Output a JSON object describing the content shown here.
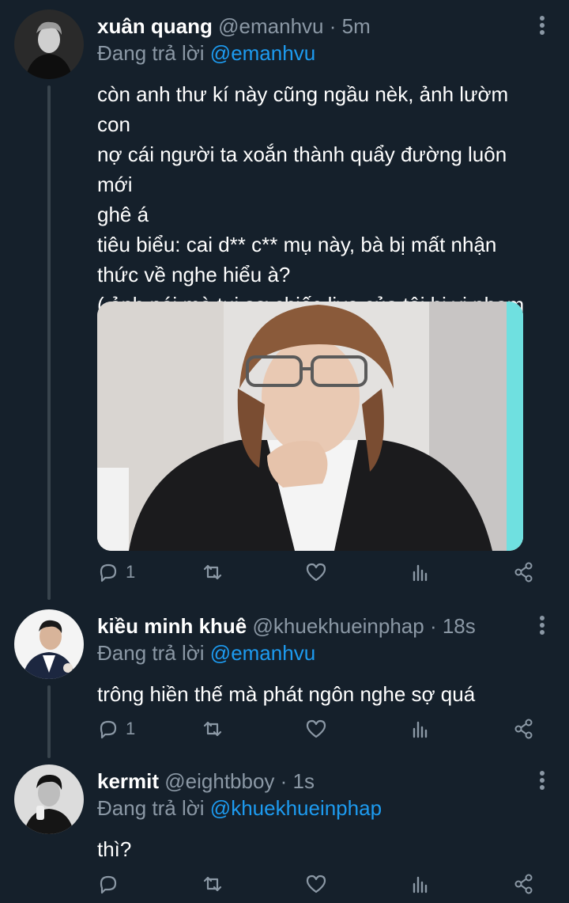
{
  "tweets": [
    {
      "name": "xuân quang",
      "handle": "@emanhvu",
      "time": "· 5m",
      "reply_prefix": "Đang trả lời",
      "reply_to": "@emanhvu",
      "text": "còn anh thư kí này cũng ngầu nèk, ảnh lườm con\nnợ cái người ta xoắn thành quẩy đường luôn mới\nghê á\ntiêu biểu: cai d** c** mụ này, bà bị mất nhận\nthức về nghe hiểu à?\n( ảnh nói mà tui sợ chiếc live của tôi bị vi phạm\ntiêu chuẩn cộng đồng",
      "text_suffix": ")",
      "reply_count": "1",
      "avatar_icon": "user-avatar-icon"
    },
    {
      "name": "kiều minh khuê",
      "handle": "@khuekhueinphap",
      "time": "· 18s",
      "reply_prefix": "Đang trả lời",
      "reply_to": "@emanhvu",
      "text": "trông hiền thế mà phát ngôn nghe sợ quá",
      "reply_count": "1",
      "avatar_icon": "user-avatar-icon"
    },
    {
      "name": "kermit",
      "handle": "@eightbboy",
      "time": "· 1s",
      "reply_prefix": "Đang trả lời",
      "reply_to": "@khuekhueinphap",
      "text": "thì?",
      "reply_count": "",
      "avatar_icon": "user-avatar-icon"
    }
  ],
  "icons": {
    "reply": "reply-icon",
    "retweet": "retweet-icon",
    "like": "heart-icon",
    "views": "views-icon",
    "share": "share-icon",
    "more": "more-options-icon",
    "emoji": "loudly-crying-face-emoji"
  },
  "colors": {
    "background": "#15202b",
    "text": "#ffffff",
    "secondary": "#8b98a5",
    "link": "#1d9bf0",
    "thread_line": "#38444d"
  }
}
